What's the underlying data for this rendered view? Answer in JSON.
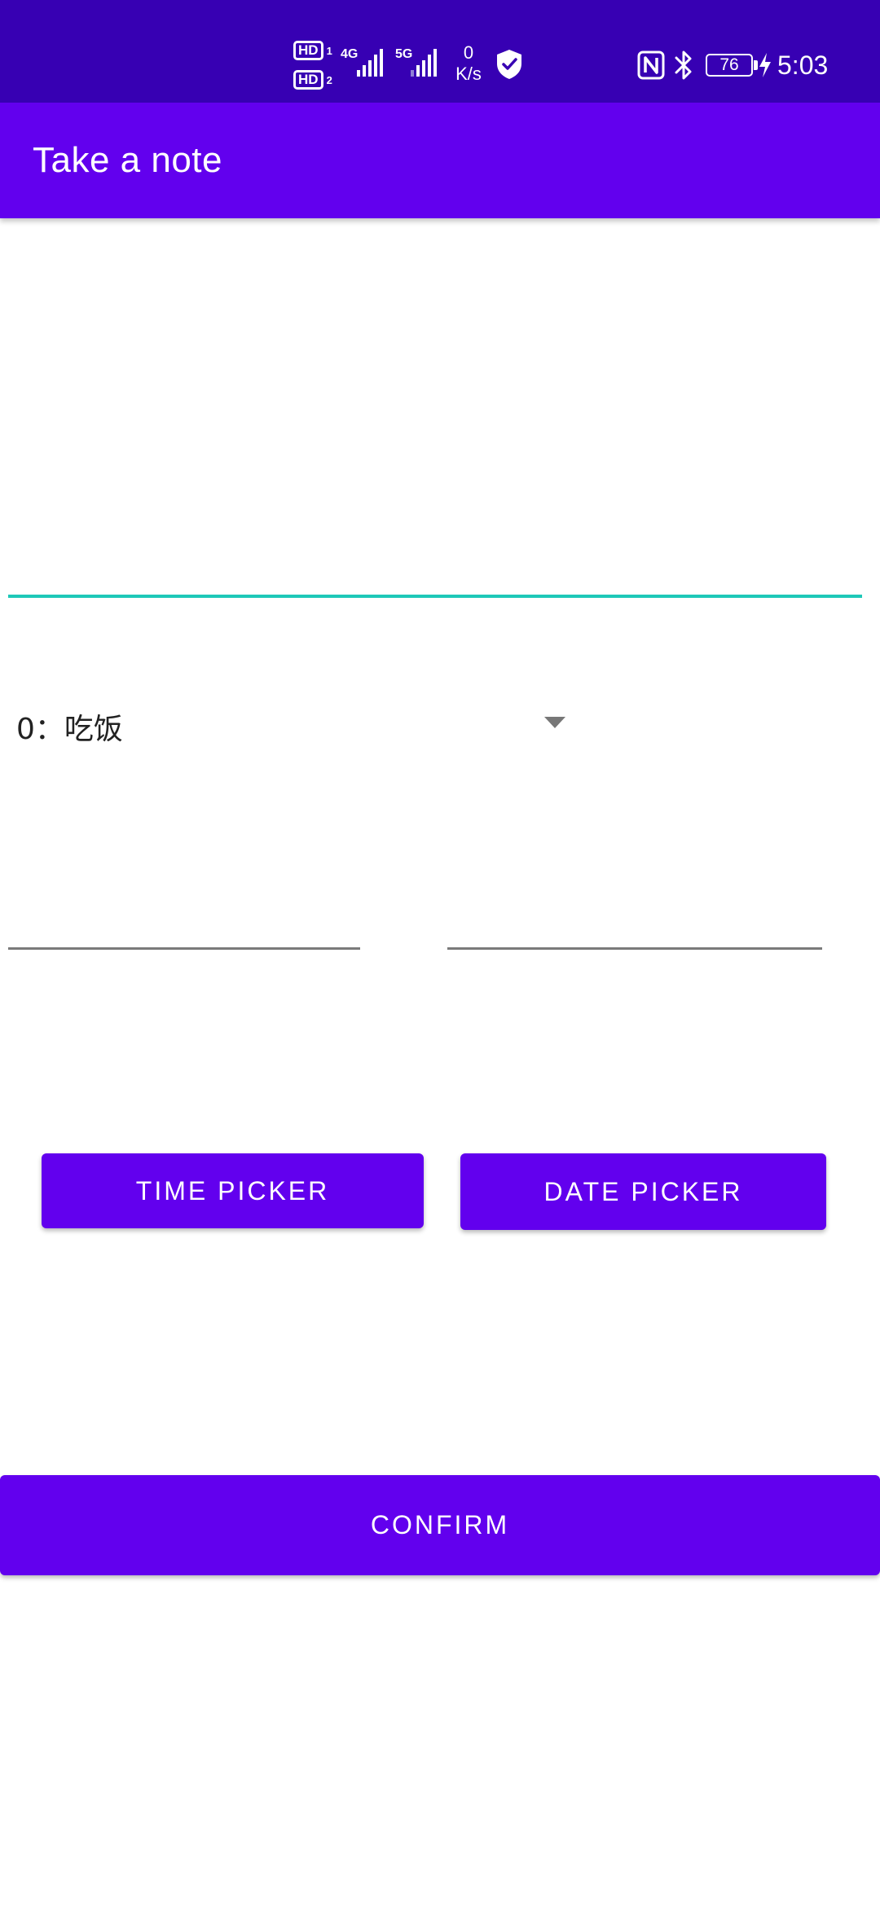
{
  "status_bar": {
    "hd1": "HD",
    "hd1_sub": "1",
    "hd2": "HD",
    "hd2_sub": "2",
    "net1": "4G",
    "net2": "5G",
    "speed_value": "0",
    "speed_unit": "K/s",
    "battery": "76",
    "time": "5:03",
    "icons": [
      "shield-icon",
      "nfc-icon",
      "bluetooth-icon",
      "charging-icon",
      "signal-icon"
    ]
  },
  "app_bar": {
    "title": "Take a note"
  },
  "note_input": {
    "value": "",
    "accent_color": "#1ec8b8"
  },
  "spinner": {
    "selected": "0：吃饭"
  },
  "time_input": {
    "value": ""
  },
  "date_input": {
    "value": ""
  },
  "buttons": {
    "time_picker": "TIME PICKER",
    "date_picker": "DATE PICKER",
    "confirm": "CONFIRM"
  },
  "colors": {
    "status_bar": "#3700b3",
    "primary": "#6200ee",
    "on_primary": "#ffffff"
  }
}
